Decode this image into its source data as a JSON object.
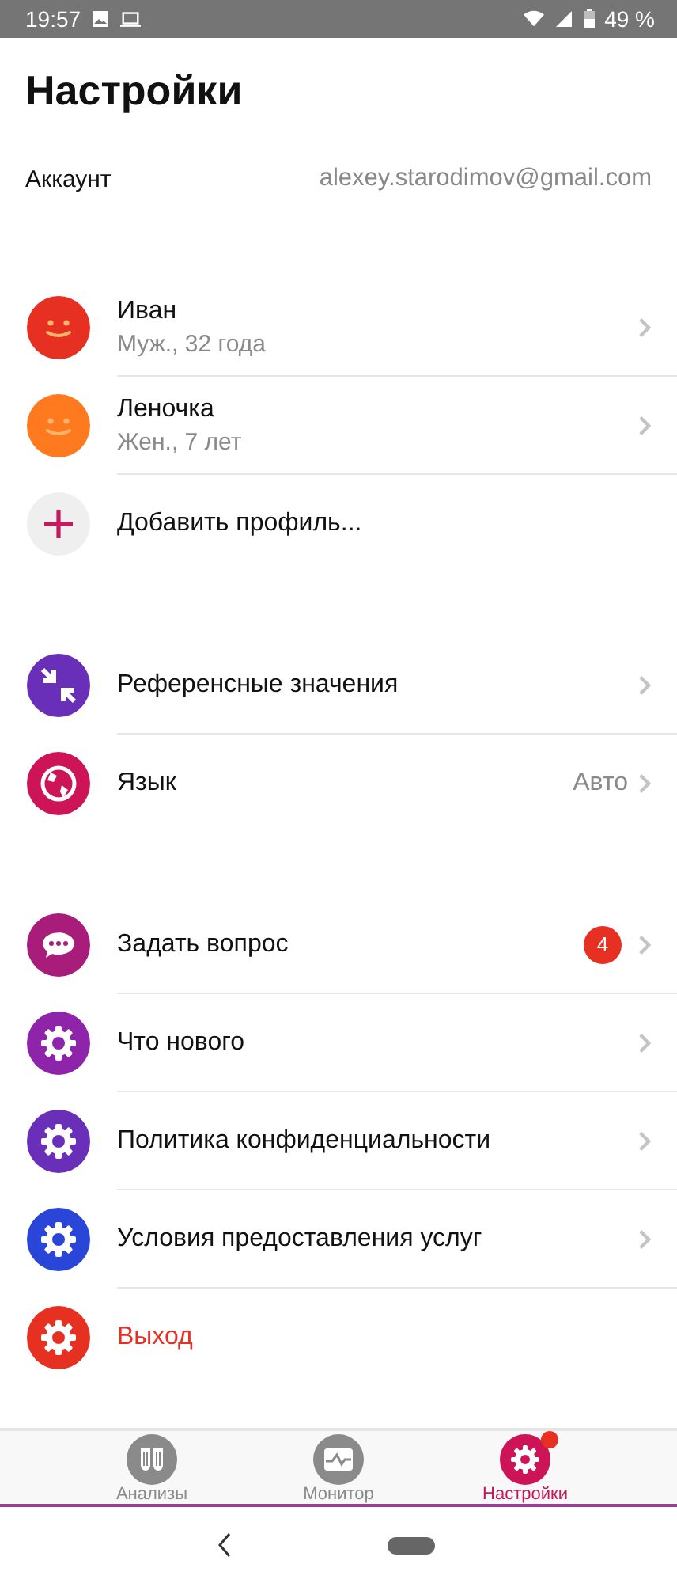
{
  "status_bar": {
    "time": "19:57",
    "battery": "49 %"
  },
  "title": "Настройки",
  "account": {
    "label": "Аккаунт",
    "value": "alexey.starodimov@gmail.com"
  },
  "sections": [
    {
      "items": [
        {
          "kind": "profile",
          "color": "#e63022",
          "title": "Иван",
          "subtitle": "Муж., 32 года",
          "chevron": true
        },
        {
          "kind": "profile",
          "color": "#ff7a1f",
          "title": "Леночка",
          "subtitle": "Жен., 7 лет",
          "chevron": true
        },
        {
          "kind": "add",
          "color": "#c8175d",
          "title": "Добавить профиль...",
          "chevron": false
        }
      ]
    },
    {
      "items": [
        {
          "kind": "reference",
          "color": "#6a2fb8",
          "title": "Референсные значения",
          "chevron": true
        },
        {
          "kind": "language",
          "color": "#cc1457",
          "title": "Язык",
          "value": "Авто",
          "chevron": true
        }
      ]
    },
    {
      "items": [
        {
          "kind": "question",
          "color": "#a81c7a",
          "title": "Задать вопрос",
          "badge": "4",
          "chevron": true
        },
        {
          "kind": "info",
          "color": "#8e24aa",
          "title": "Что нового",
          "chevron": true
        },
        {
          "kind": "info",
          "color": "#6a2fb8",
          "title": "Политика конфиденциальности",
          "chevron": true
        },
        {
          "kind": "info",
          "color": "#2946d8",
          "title": "Условия предоставления услуг",
          "chevron": true
        },
        {
          "kind": "logout",
          "color": "#e63022",
          "title": "Выход",
          "chevron": false
        }
      ]
    }
  ],
  "tabs": [
    {
      "label": "Анализы",
      "selected": false,
      "dot": false
    },
    {
      "label": "Монитор",
      "selected": false,
      "dot": false
    },
    {
      "label": "Настройки",
      "selected": true,
      "dot": true
    }
  ]
}
